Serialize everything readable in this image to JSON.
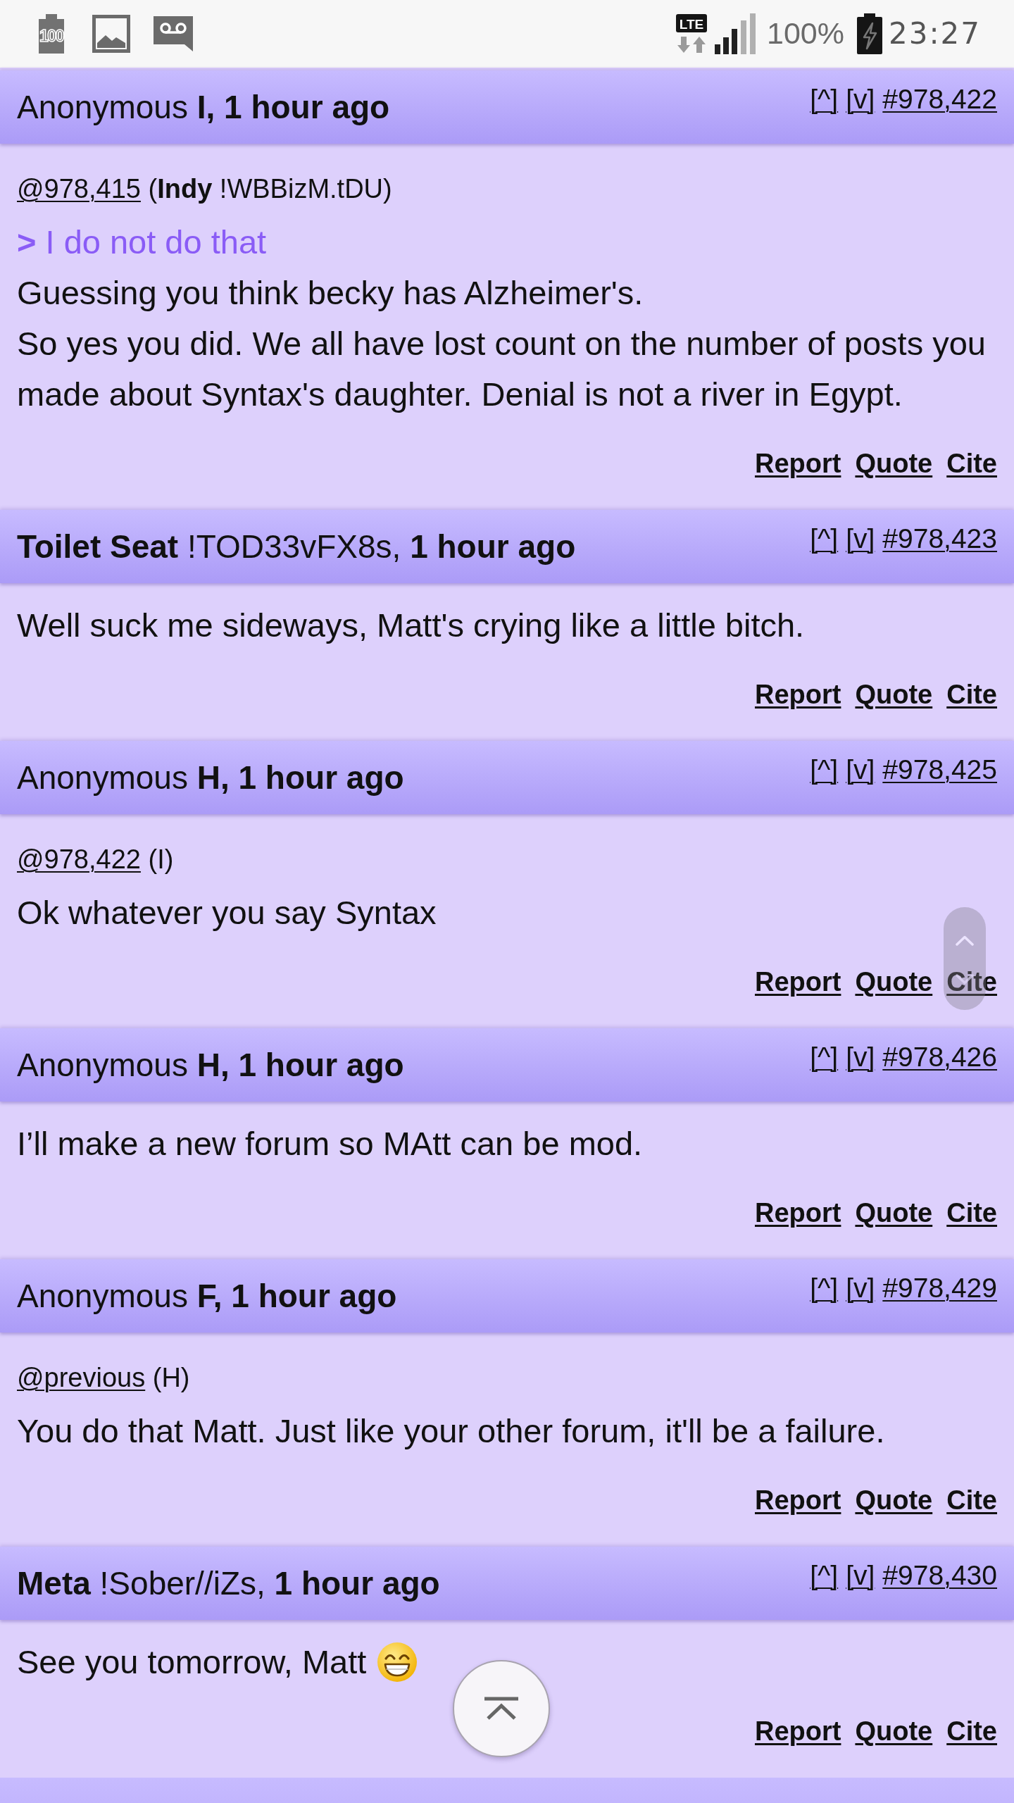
{
  "status_bar": {
    "notification_count": "100",
    "network": "LTE",
    "battery": "100%",
    "time": "23:27"
  },
  "posts": [
    {
      "kind": "full",
      "byline": "Anonymous **I, 1 hour ago**",
      "nav": [
        "[^]",
        "[v]"
      ],
      "number": "#978,422",
      "body": [
        {
          "kind": "reply",
          "link": "@978,415",
          "note": "(**Indy** !WBBizM.tDU)"
        },
        {
          "kind": "quote",
          "text": "**>** I do not do that"
        },
        {
          "kind": "text",
          "text": "Guessing you think becky has Alzheimer's."
        },
        {
          "kind": "text",
          "text": "So yes you did. We all have lost count on the number of posts you made about Syntax's daughter. Denial is not a river in Egypt."
        }
      ],
      "actions": [
        "Report",
        "Quote",
        "Cite"
      ]
    },
    {
      "kind": "full",
      "byline": "**Toilet Seat** !TOD33vFX8s, **1 hour ago**",
      "nav": [
        "[^]",
        "[v]"
      ],
      "number": "#978,423",
      "body": [
        {
          "kind": "text",
          "text": "Well suck me sideways, Matt's crying like a little bitch."
        }
      ],
      "actions": [
        "Report",
        "Quote",
        "Cite"
      ]
    },
    {
      "kind": "full",
      "byline": "Anonymous **H, 1 hour ago**",
      "nav": [
        "[^]",
        "[v]"
      ],
      "number": "#978,425",
      "body": [
        {
          "kind": "reply",
          "link": "@978,422",
          "note": "(I)"
        },
        {
          "kind": "text",
          "text": "Ok whatever you say Syntax"
        }
      ],
      "actions": [
        "Report",
        "Quote",
        "Cite"
      ]
    },
    {
      "kind": "full",
      "byline": "Anonymous **H, 1 hour ago**",
      "nav": [
        "[^]",
        "[v]"
      ],
      "number": "#978,426",
      "body": [
        {
          "kind": "text",
          "text": "I’ll make a new forum so MAtt can be mod."
        }
      ],
      "actions": [
        "Report",
        "Quote",
        "Cite"
      ]
    },
    {
      "kind": "full",
      "byline": "Anonymous **F, 1 hour ago**",
      "nav": [
        "[^]",
        "[v]"
      ],
      "number": "#978,429",
      "body": [
        {
          "kind": "reply",
          "link": "@previous",
          "note": "(H)"
        },
        {
          "kind": "text",
          "text": "You do that Matt. Just like your other forum, it'll be a failure."
        }
      ],
      "actions": [
        "Report",
        "Quote",
        "Cite"
      ]
    },
    {
      "kind": "full",
      "byline": "**Meta** !Sober//iZs, **1 hour ago**",
      "nav": [
        "[^]",
        "[v]"
      ],
      "number": "#978,430",
      "body": [
        {
          "kind": "text_emoji",
          "text": "See you tomorrow, Matt"
        }
      ],
      "actions": [
        "Report",
        "Quote",
        "Cite"
      ]
    },
    {
      "kind": "cut_off"
    }
  ]
}
